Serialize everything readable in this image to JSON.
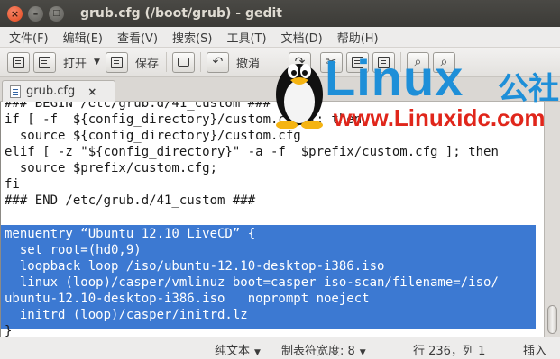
{
  "window": {
    "title": "grub.cfg (/boot/grub) - gedit",
    "controls": {
      "close": "×",
      "minimize": "–",
      "maximize": "□"
    }
  },
  "menubar": {
    "items": [
      "文件(F)",
      "编辑(E)",
      "查看(V)",
      "搜索(S)",
      "工具(T)",
      "文档(D)",
      "帮助(H)"
    ]
  },
  "toolbar": {
    "open_label": "打开",
    "save_label": "保存",
    "undo_label": "撤消",
    "icons": [
      "new-document-icon",
      "open-icon",
      "save-icon",
      "print-icon",
      "undo-icon",
      "redo-icon",
      "cut-icon",
      "copy-icon",
      "paste-icon",
      "find-icon",
      "replace-icon"
    ]
  },
  "tab": {
    "label": "grub.cfg",
    "close": "×"
  },
  "editor": {
    "lines": [
      "### BEGIN /etc/grub.d/41_custom ###",
      "if [ -f  ${config_directory}/custom.cfg ]; then",
      "  source ${config_directory}/custom.cfg",
      "elif [ -z \"${config_directory}\" -a -f  $prefix/custom.cfg ]; then",
      "  source $prefix/custom.cfg;",
      "fi",
      "### END /etc/grub.d/41_custom ###",
      "",
      "menuentry “Ubuntu 12.10 LiveCD” {",
      "  set root=(hd0,9)",
      "  loopback loop /iso/ubuntu-12.10-desktop-i386.iso",
      "  linux (loop)/casper/vmlinuz boot=casper iso-scan/filename=/iso/",
      "ubuntu-12.10-desktop-i386.iso   noprompt noeject",
      "  initrd (loop)/casper/initrd.lz",
      "}"
    ]
  },
  "statusbar": {
    "language": "纯文本",
    "tab_width_label": "制表符宽度: 8",
    "position": "行 236，列 1",
    "mode": "插入"
  },
  "watermark": {
    "brand": "Linux",
    "brand_cn": "公社",
    "url": "www.Linuxidc.com"
  },
  "colors": {
    "selection": "#3c79d2",
    "titlebar": "#3c3b37",
    "close_button": "#e2461b",
    "watermark_blue": "#1e8fd8",
    "watermark_red": "#e0261b"
  }
}
